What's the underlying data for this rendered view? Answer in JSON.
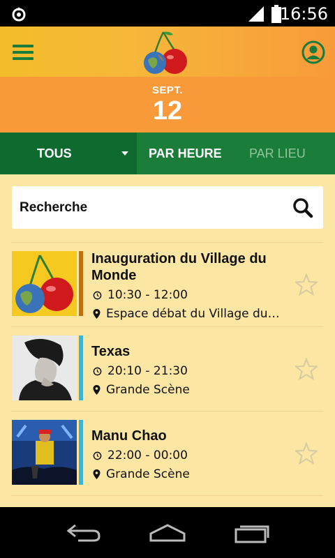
{
  "status_bar": {
    "time": "16:56",
    "icons": [
      "notification-icon",
      "signal-icon",
      "battery-icon"
    ]
  },
  "header": {
    "logo": "cherries-globe-logo",
    "menu_icon": "hamburger-menu-icon",
    "profile_icon": "account-icon"
  },
  "date": {
    "month": "SEPT.",
    "day": "12"
  },
  "tabs": {
    "filter": "TOUS",
    "by_hour": "PAR HEURE",
    "by_place": "PAR LIEU"
  },
  "search": {
    "placeholder": "Recherche"
  },
  "events": [
    {
      "title": "Inauguration du Village du Monde",
      "time": "10:30 - 12:00",
      "place": "Espace débat du Village du…",
      "accent": "#c0700b"
    },
    {
      "title": "Texas",
      "time": "20:10 - 21:30",
      "place": "Grande Scène",
      "accent": "#3cb4d4"
    },
    {
      "title": "Manu Chao",
      "time": "22:00 - 00:00",
      "place": "Grande Scène",
      "accent": "#3cb4d4"
    }
  ],
  "colors": {
    "green_dark": "#0e6a2e",
    "green": "#1b7d3a",
    "orange": "#f89a3a",
    "list_bg": "#fce6a3"
  }
}
